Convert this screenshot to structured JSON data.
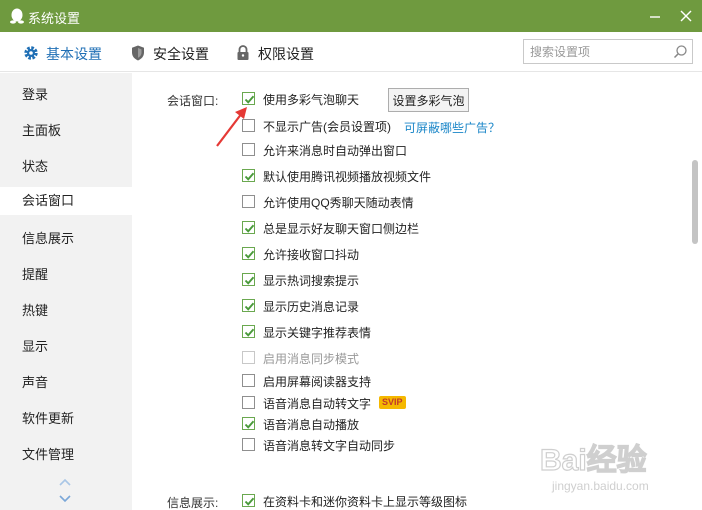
{
  "window": {
    "title": "系统设置"
  },
  "tabs": [
    {
      "label": "基本设置",
      "icon": "gear-icon",
      "active": true
    },
    {
      "label": "安全设置",
      "icon": "shield-icon",
      "active": false
    },
    {
      "label": "权限设置",
      "icon": "lock-icon",
      "active": false
    }
  ],
  "search": {
    "placeholder": "搜索设置项",
    "value": ""
  },
  "sidebar": {
    "items": [
      {
        "label": "登录"
      },
      {
        "label": "主面板"
      },
      {
        "label": "状态"
      },
      {
        "label": "会话窗口",
        "active": true
      },
      {
        "label": "信息展示"
      },
      {
        "label": "提醒"
      },
      {
        "label": "热键"
      },
      {
        "label": "显示"
      },
      {
        "label": "声音"
      },
      {
        "label": "软件更新"
      },
      {
        "label": "文件管理"
      }
    ]
  },
  "session": {
    "label": "会话窗口:",
    "set_bubble_button": "设置多彩气泡",
    "ads_link": "可屏蔽哪些广告？",
    "options": [
      {
        "label": "使用多彩气泡聊天",
        "checked": true
      },
      {
        "label": "不显示广告(会员设置项)",
        "checked": false
      },
      {
        "label": "允许来消息时自动弹出窗口",
        "checked": false
      },
      {
        "label": "默认使用腾讯视频播放视频文件",
        "checked": true
      },
      {
        "label": "允许使用QQ秀聊天随动表情",
        "checked": false
      },
      {
        "label": "总是显示好友聊天窗口侧边栏",
        "checked": true
      },
      {
        "label": "允许接收窗口抖动",
        "checked": true
      },
      {
        "label": "显示热词搜索提示",
        "checked": true
      },
      {
        "label": "显示历史消息记录",
        "checked": true
      },
      {
        "label": "显示关键字推荐表情",
        "checked": true
      },
      {
        "label": "启用消息同步模式",
        "checked": false,
        "disabled": true
      },
      {
        "label": "启用屏幕阅读器支持",
        "checked": false
      },
      {
        "label": "语音消息自动转文字",
        "checked": false,
        "badge": "SVIP"
      },
      {
        "label": "语音消息自动播放",
        "checked": true
      },
      {
        "label": "语音消息转文字自动同步",
        "checked": false
      }
    ]
  },
  "info": {
    "label": "信息展示:",
    "options": [
      {
        "label": "在资料卡和迷你资料卡上显示等级图标",
        "checked": true
      }
    ]
  },
  "colors": {
    "titlebar": "#6f9a3f",
    "accent": "#1f6fb5",
    "check": "#4a9a3a",
    "annotation_arrow": "#e53935",
    "link": "#1a86c8"
  },
  "watermark": {
    "text": "Bai经验",
    "subtext": "jingyan.baidu.com"
  }
}
